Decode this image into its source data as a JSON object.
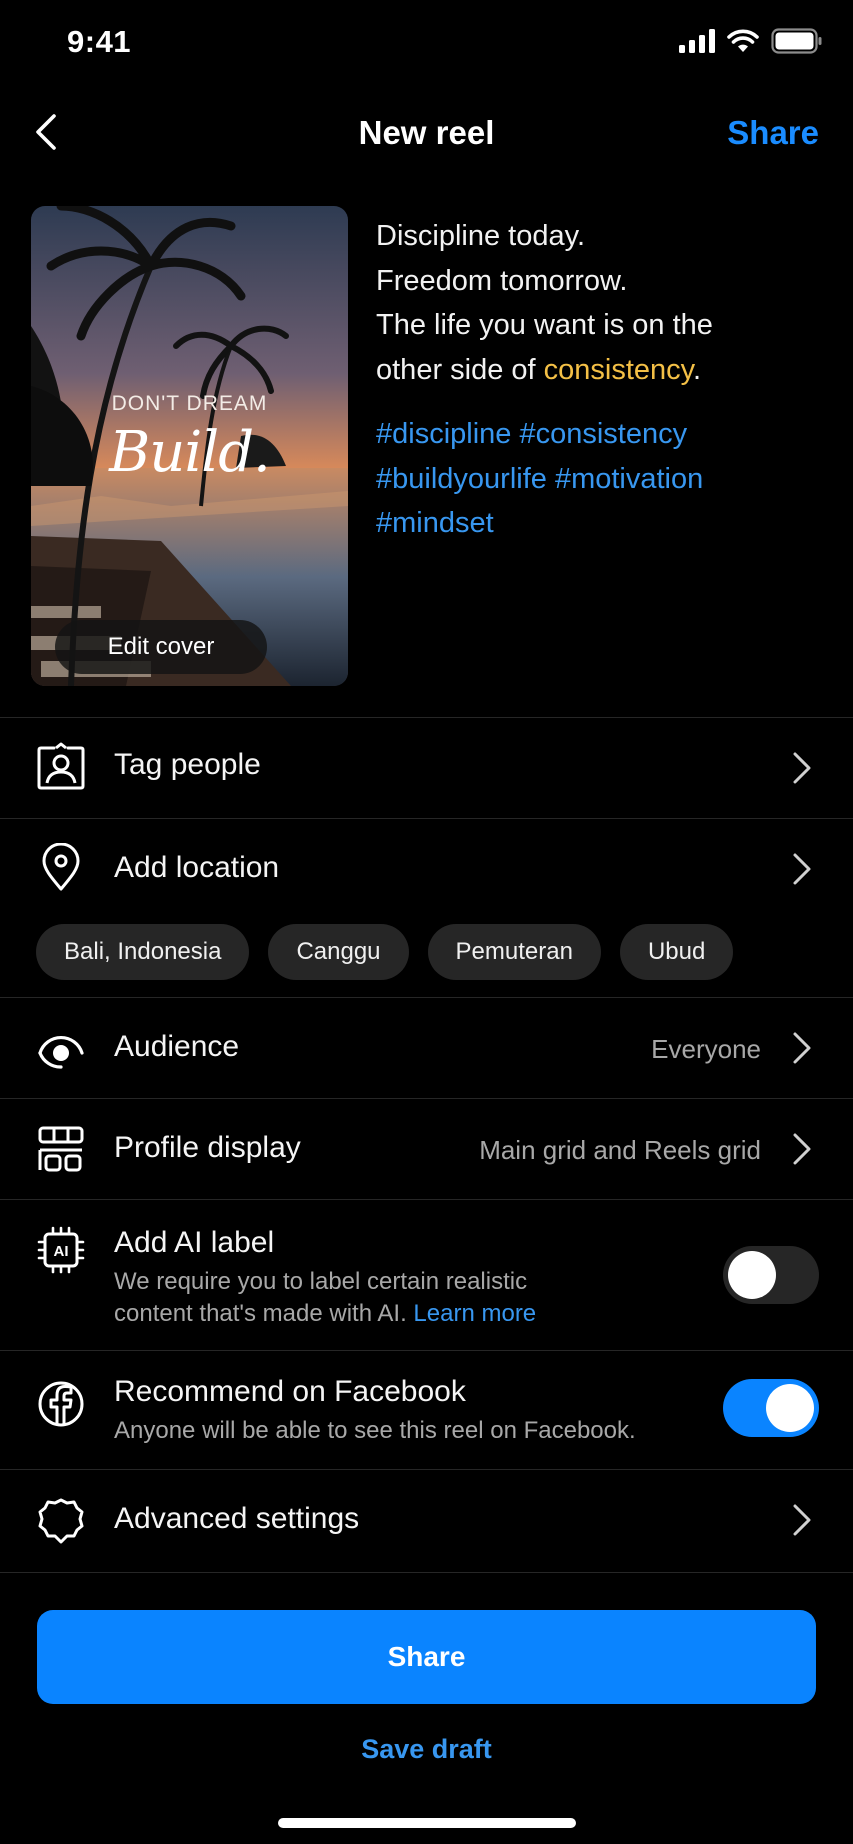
{
  "status_bar": {
    "time": "9:41"
  },
  "header": {
    "title": "New reel",
    "share_label": "Share"
  },
  "cover": {
    "small_text": "DON'T DREAM",
    "big_text": "Build.",
    "edit_label": "Edit cover"
  },
  "caption": {
    "line1": "Discipline today.",
    "line2": "Freedom tomorrow.",
    "line3": "The life you want is on the",
    "line4_prefix": "other side of ",
    "line4_highlight": "consistency",
    "line4_suffix": ".",
    "highlight_color": "#f4c046",
    "hashtags_line1": "#discipline #consistency",
    "hashtags_line2": "#buildyourlife #motivation",
    "hashtags_line3": "#mindset"
  },
  "rows": {
    "tag_people": {
      "label": "Tag people",
      "icon": "tag-person-icon"
    },
    "add_location": {
      "label": "Add location",
      "icon": "location-pin-icon"
    },
    "audience": {
      "label": "Audience",
      "value": "Everyone",
      "icon": "audience-eye-icon"
    },
    "profile_display": {
      "label": "Profile display",
      "value": "Main grid and Reels grid",
      "icon": "grid-display-icon"
    },
    "ai_label": {
      "label": "Add AI label",
      "sub_line1": "We require you to label certain realistic",
      "sub_line2_prefix": "content that's made with AI. ",
      "sub_line2_link": "Learn more",
      "toggle_on": false,
      "icon": "ai-chip-icon"
    },
    "recommend_facebook": {
      "label": "Recommend on Facebook",
      "sub": "Anyone will be able to see this reel on Facebook.",
      "toggle_on": true,
      "icon": "facebook-icon"
    },
    "advanced": {
      "label": "Advanced settings",
      "icon": "gear-icon"
    }
  },
  "location_chips": [
    "Bali, Indonesia",
    "Canggu",
    "Pemuteran",
    "Ubud"
  ],
  "footer": {
    "share_label": "Share",
    "save_draft_label": "Save draft"
  },
  "colors": {
    "accent": "#0a84ff",
    "link": "#3897f0",
    "background": "#000000"
  }
}
